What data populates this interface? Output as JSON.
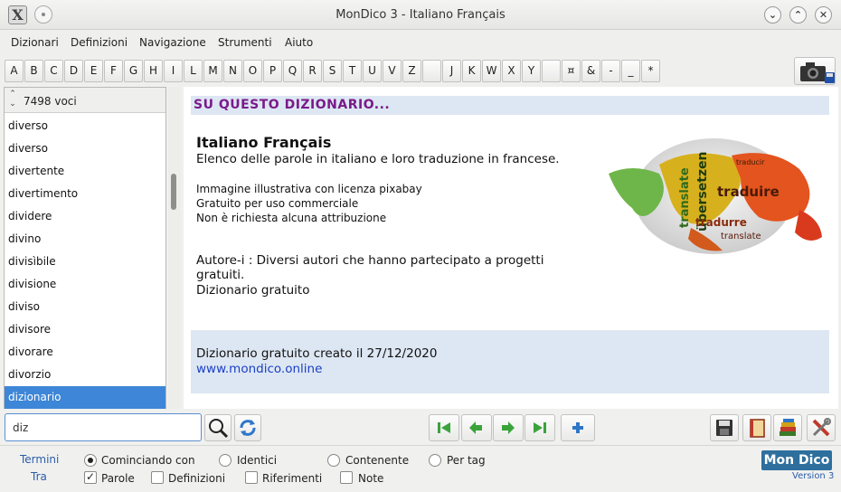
{
  "window": {
    "title": "MonDico 3 - Italiano Français"
  },
  "menu": [
    "Dizionari",
    "Definizioni",
    "Navigazione",
    "Strumenti",
    "Aiuto"
  ],
  "letters": [
    "A",
    "B",
    "C",
    "D",
    "E",
    "F",
    "G",
    "H",
    "I",
    "L",
    "M",
    "N",
    "O",
    "P",
    "Q",
    "R",
    "S",
    "T",
    "U",
    "V",
    "Z",
    " ",
    "J",
    "K",
    "W",
    "X",
    "Y",
    " ",
    "¤",
    "&",
    "-",
    "_",
    "*"
  ],
  "list": {
    "count": "7498 voci",
    "items": [
      "diverso",
      "diverso",
      "divertente",
      "divertimento",
      "dividere",
      "divino",
      "divisìbile",
      "divisione",
      "diviso",
      "divisore",
      "divorare",
      "divorzio",
      "dizionario"
    ],
    "selected_index": 12
  },
  "content": {
    "section_title": "SU QUESTO DIZIONARIO...",
    "dict_title": "Italiano Français",
    "dict_description": "Elenco delle parole in italiano e loro traduzione in francese.",
    "info_lines": [
      "Immagine illustrativa con licenza pixabay",
      "Gratuito per uso commerciale",
      "Non è richiesta alcuna attribuzione"
    ],
    "author": "Autore-i : Diversi autori che hanno partecipato a progetti gratuiti.",
    "free_label": "Dizionario gratuito",
    "created": "Dizionario gratuito creato il 27/12/2020",
    "website": "www.mondico.online",
    "image_words": [
      "translate",
      "übersetzen",
      "traduire",
      "tradurre",
      "traducir",
      "translate"
    ]
  },
  "search": {
    "value": "diz"
  },
  "options": {
    "labels": [
      "Termini",
      "Tra"
    ],
    "radios": [
      {
        "label": "Cominciando con",
        "checked": true
      },
      {
        "label": "Identici",
        "checked": false
      },
      {
        "label": "Contenente",
        "checked": false
      },
      {
        "label": "Per tag",
        "checked": false
      }
    ],
    "checks": [
      {
        "label": "Parole",
        "checked": true
      },
      {
        "label": "Definizioni",
        "checked": false
      },
      {
        "label": "Riferimenti",
        "checked": false
      },
      {
        "label": "Note",
        "checked": false
      }
    ]
  },
  "branding": {
    "logo": "Mon Dico",
    "version": "Version 3"
  },
  "colors": {
    "selection": "#3d86d8",
    "section_title": "#7a1a8a",
    "link": "#1a3fc5",
    "panel_blue": "#dde7f3"
  }
}
